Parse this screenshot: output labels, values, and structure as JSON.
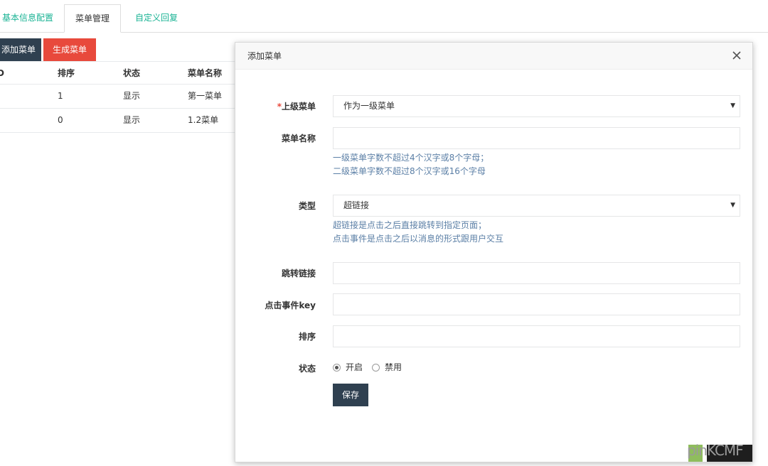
{
  "tabs": [
    {
      "label": "基本信息配置"
    },
    {
      "label": "菜单管理"
    },
    {
      "label": "自定义回复"
    }
  ],
  "toolbar": {
    "add_label": "添加菜单",
    "generate_label": "生成菜单"
  },
  "table": {
    "headers": [
      "D",
      "排序",
      "状态",
      "菜单名称"
    ],
    "rows": [
      {
        "id": "",
        "order": "1",
        "status": "显示",
        "name": "第一菜单"
      },
      {
        "id": "",
        "order": "0",
        "status": "显示",
        "name": "1.2菜单"
      }
    ]
  },
  "modal": {
    "title": "添加菜单",
    "close_icon": "close-icon",
    "fields": {
      "parent": {
        "required_mark": "*",
        "label": "上级菜单",
        "value": "作为一级菜单"
      },
      "name": {
        "label": "菜单名称",
        "value": "",
        "hint1": "一级菜单字数不超过4个汉字或8个字母；",
        "hint2": "二级菜单字数不超过8个汉字或16个字母"
      },
      "type": {
        "label": "类型",
        "value": "超链接",
        "hint1": "超链接是点击之后直接跳转到指定页面；",
        "hint2": "点击事件是点击之后以消息的形式跟用户交互"
      },
      "link": {
        "label": "跳转链接",
        "value": ""
      },
      "event_key": {
        "label": "点击事件key",
        "value": ""
      },
      "order": {
        "label": "排序",
        "value": ""
      },
      "status": {
        "label": "状态",
        "options": [
          "开启",
          "禁用"
        ],
        "selected": "开启"
      }
    },
    "save_label": "保存"
  },
  "watermark": {
    "text": "pinKCMF"
  },
  "colors": {
    "accent": "#1ab394",
    "dark": "#2f4050",
    "danger": "#e8493c",
    "hint": "#5b7fa6"
  }
}
